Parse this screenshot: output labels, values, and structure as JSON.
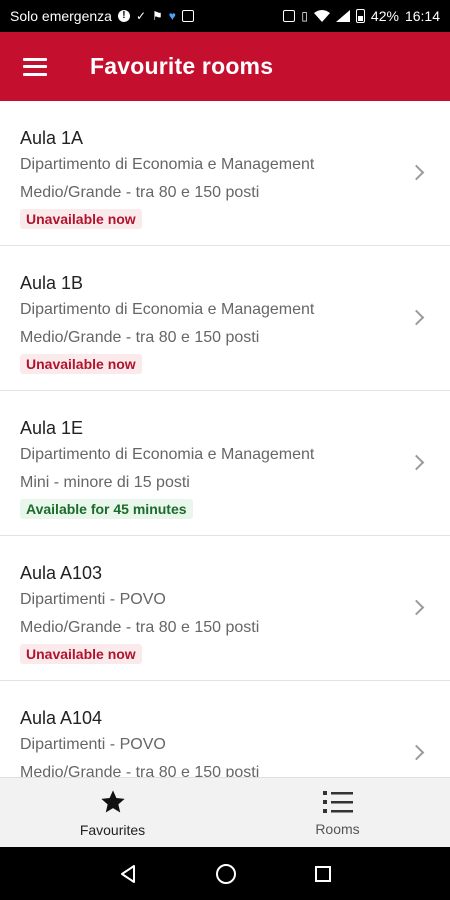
{
  "status_bar": {
    "carrier": "Solo emergenza",
    "battery": "42%",
    "time": "16:14"
  },
  "app_bar": {
    "title": "Favourite rooms"
  },
  "rooms": [
    {
      "name": "Aula 1A",
      "department": "Dipartimento di Economia e Management",
      "size": "Medio/Grande - tra 80 e 150 posti",
      "status": "Unavailable now",
      "status_type": "unavailable"
    },
    {
      "name": "Aula 1B",
      "department": "Dipartimento di Economia e Management",
      "size": "Medio/Grande - tra 80 e 150 posti",
      "status": "Unavailable now",
      "status_type": "unavailable"
    },
    {
      "name": "Aula 1E",
      "department": "Dipartimento di Economia e Management",
      "size": "Mini - minore di 15 posti",
      "status": "Available for 45 minutes",
      "status_type": "available"
    },
    {
      "name": "Aula A103",
      "department": "Dipartimenti - POVO",
      "size": "Medio/Grande - tra 80 e 150 posti",
      "status": "Unavailable now",
      "status_type": "unavailable"
    },
    {
      "name": "Aula A104",
      "department": "Dipartimenti - POVO",
      "size": "Medio/Grande - tra 80 e 150 posti",
      "status": "",
      "status_type": "unavailable"
    }
  ],
  "bottom_nav": {
    "favourites_label": "Favourites",
    "rooms_label": "Rooms"
  },
  "colors": {
    "primary": "#c4102e",
    "unavailable_text": "#b0142c",
    "available_text": "#1b6b2a"
  },
  "icons": {
    "menu": "hamburger-icon",
    "favourites": "star-icon",
    "rooms": "list-icon",
    "chevron": "chevron-right-icon"
  }
}
